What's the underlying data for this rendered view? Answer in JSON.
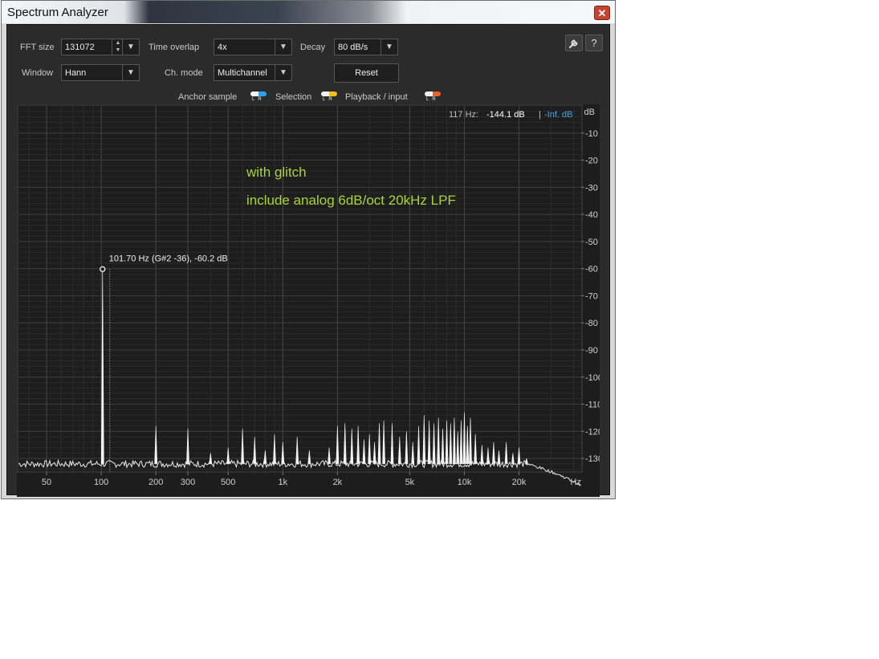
{
  "window": {
    "title": "Spectrum Analyzer",
    "close_symbol": "✕"
  },
  "controls": {
    "fft_size": {
      "label": "FFT size",
      "value": "131072"
    },
    "time_overlap": {
      "label": "Time overlap",
      "value": "4x"
    },
    "decay": {
      "label": "Decay",
      "value": "80 dB/s"
    },
    "window_fn": {
      "label": "Window",
      "value": "Hann"
    },
    "ch_mode": {
      "label": "Ch. mode",
      "value": "Multichannel"
    },
    "reset_label": "Reset",
    "settings_icon": "wrench-icon",
    "help_icon": "help-icon",
    "help_symbol": "?"
  },
  "legend": {
    "anchor_sample": "Anchor sample",
    "selection": "Selection",
    "playback_input": "Playback / input",
    "lr": "LR",
    "colors": {
      "anchor": "#2ea2f0",
      "selection": "#f0c020",
      "playback": "#e8622a"
    }
  },
  "readout": {
    "freq": "117 Hz:",
    "level": "-144.1 dB",
    "separator": "|",
    "level2": "-Inf. dB"
  },
  "annotations": {
    "line1": "with glitch",
    "line2": "include analog 6dB/oct 20kHz LPF",
    "color": "#a8d436"
  },
  "marker": {
    "label": "101.70 Hz (G#2 -36), -60.2 dB",
    "freq_hz": 101.7,
    "db": -60.2
  },
  "chart_data": {
    "type": "line",
    "x_scale": "log",
    "xlim": [
      35,
      44000
    ],
    "ylim": [
      -135,
      0
    ],
    "grid": true,
    "x_ticks": [
      {
        "v": 50,
        "label": "50"
      },
      {
        "v": 100,
        "label": "100"
      },
      {
        "v": 200,
        "label": "200"
      },
      {
        "v": 300,
        "label": "300"
      },
      {
        "v": 500,
        "label": "500"
      },
      {
        "v": 1000,
        "label": "1k"
      },
      {
        "v": 2000,
        "label": "2k"
      },
      {
        "v": 5000,
        "label": "5k"
      },
      {
        "v": 10000,
        "label": "10k"
      },
      {
        "v": 20000,
        "label": "20k"
      }
    ],
    "x_unit": "Hz",
    "y_ticks": [
      -10,
      -20,
      -30,
      -40,
      -50,
      -60,
      -70,
      -80,
      -90,
      -100,
      -110,
      -120,
      -130
    ],
    "y_unit": "dB",
    "noise_floor_db": -132,
    "peaks": [
      {
        "f": 101.7,
        "db": -60.2
      },
      {
        "f": 200,
        "db": -118
      },
      {
        "f": 300,
        "db": -119
      },
      {
        "f": 400,
        "db": -128
      },
      {
        "f": 500,
        "db": -126
      },
      {
        "f": 600,
        "db": -119
      },
      {
        "f": 700,
        "db": -122
      },
      {
        "f": 800,
        "db": -127
      },
      {
        "f": 900,
        "db": -121
      },
      {
        "f": 1000,
        "db": -124
      },
      {
        "f": 1200,
        "db": -122
      },
      {
        "f": 1400,
        "db": -127
      },
      {
        "f": 1800,
        "db": -126
      },
      {
        "f": 2000,
        "db": -118
      },
      {
        "f": 2200,
        "db": -117
      },
      {
        "f": 2400,
        "db": -119
      },
      {
        "f": 2600,
        "db": -118
      },
      {
        "f": 2800,
        "db": -123
      },
      {
        "f": 3000,
        "db": -121
      },
      {
        "f": 3200,
        "db": -124
      },
      {
        "f": 3400,
        "db": -117
      },
      {
        "f": 3600,
        "db": -116
      },
      {
        "f": 4000,
        "db": -117
      },
      {
        "f": 4400,
        "db": -122
      },
      {
        "f": 4800,
        "db": -120
      },
      {
        "f": 5200,
        "db": -124
      },
      {
        "f": 5600,
        "db": -118
      },
      {
        "f": 6000,
        "db": -114
      },
      {
        "f": 6400,
        "db": -116
      },
      {
        "f": 6800,
        "db": -117
      },
      {
        "f": 7200,
        "db": -115
      },
      {
        "f": 7600,
        "db": -119
      },
      {
        "f": 8000,
        "db": -116
      },
      {
        "f": 8400,
        "db": -117
      },
      {
        "f": 8800,
        "db": -115
      },
      {
        "f": 9200,
        "db": -120
      },
      {
        "f": 9600,
        "db": -116
      },
      {
        "f": 10000,
        "db": -113
      },
      {
        "f": 10400,
        "db": -118
      },
      {
        "f": 10800,
        "db": -115
      },
      {
        "f": 11500,
        "db": -121
      },
      {
        "f": 12500,
        "db": -125
      },
      {
        "f": 13500,
        "db": -126
      },
      {
        "f": 14500,
        "db": -124
      },
      {
        "f": 15500,
        "db": -127
      },
      {
        "f": 17000,
        "db": -124
      },
      {
        "f": 18500,
        "db": -128
      },
      {
        "f": 20000,
        "db": -126
      },
      {
        "f": 22000,
        "db": -130
      }
    ]
  }
}
